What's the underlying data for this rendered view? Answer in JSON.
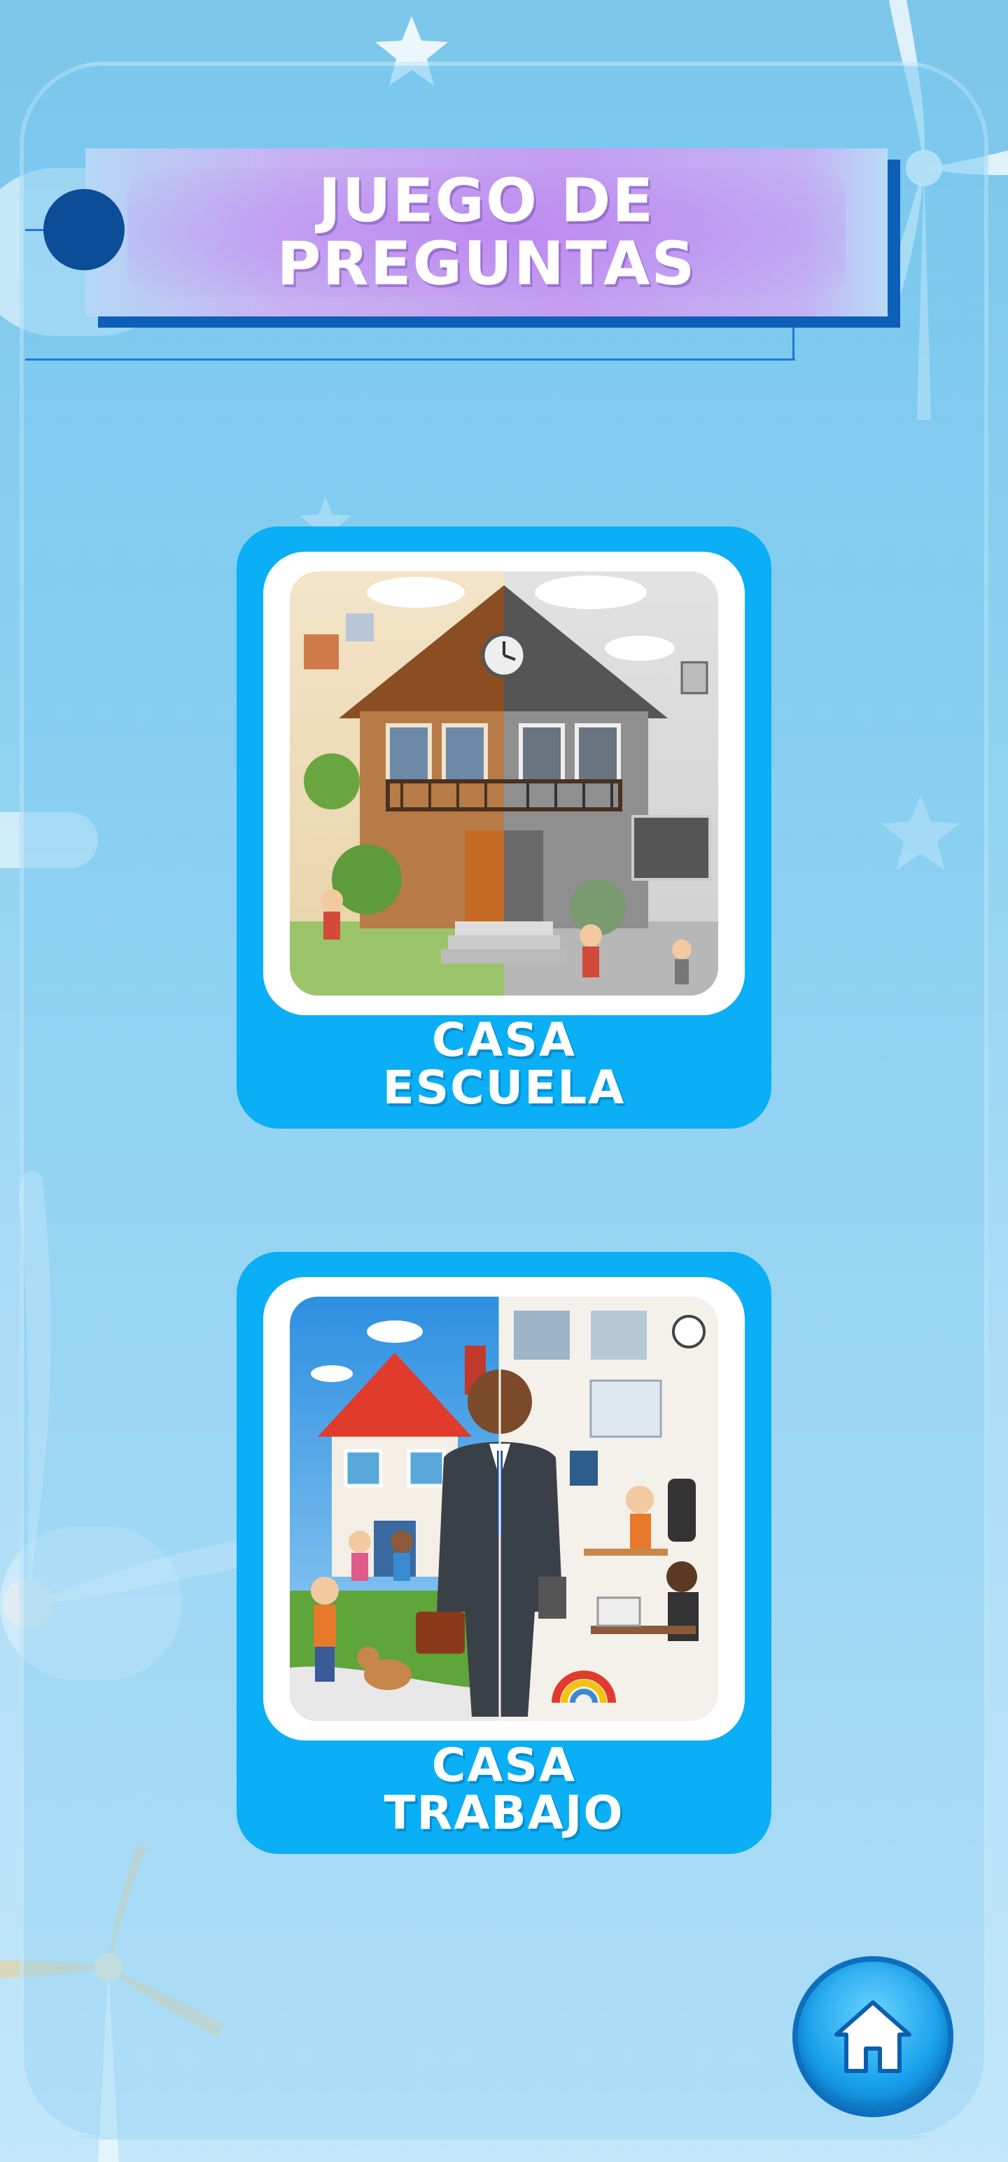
{
  "header": {
    "title_line1": "JUEGO DE",
    "title_line2": "PREGUNTAS"
  },
  "cards": [
    {
      "line1": "CASA",
      "line2": "ESCUELA",
      "image": "house-school-illustration"
    },
    {
      "line1": "CASA",
      "line2": "TRABAJO",
      "image": "house-work-illustration"
    }
  ],
  "home_button": {
    "icon": "home-icon"
  },
  "colors": {
    "card_bg": "#0aaff5",
    "title_shadow": "#0d5fb8",
    "dot": "#0b4d97",
    "accent_line": "#1d7ad6"
  }
}
